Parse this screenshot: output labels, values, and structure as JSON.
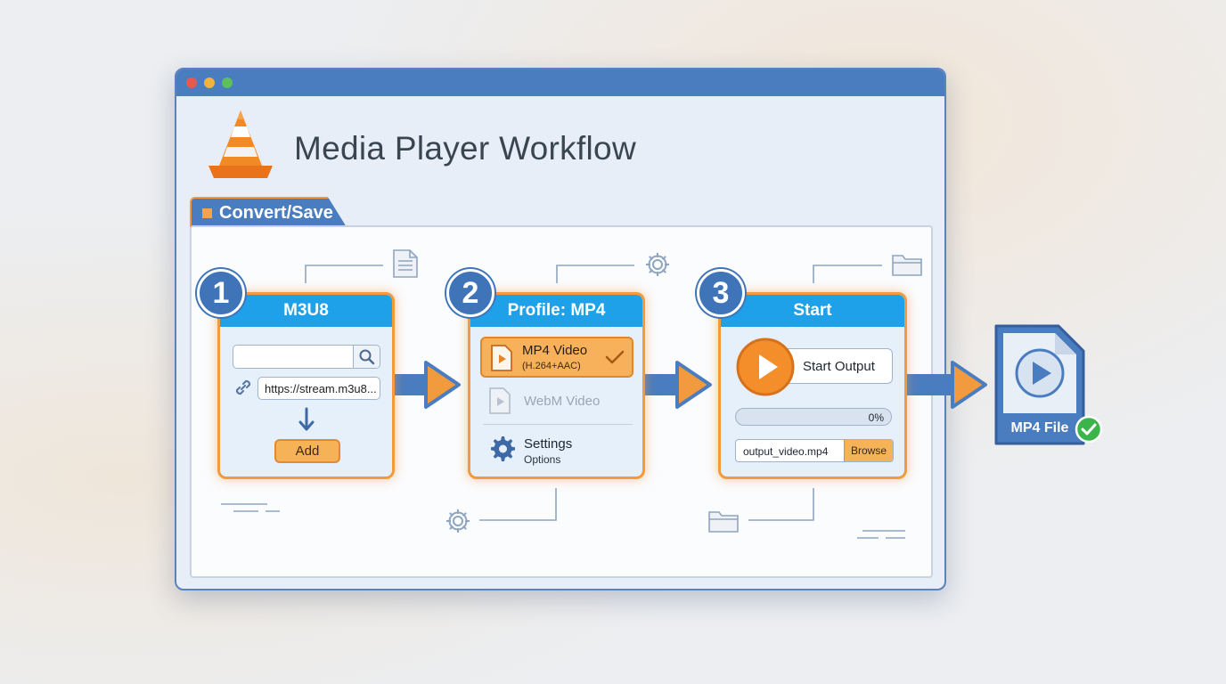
{
  "app": {
    "title": "Media Player Workflow"
  },
  "tab": {
    "label": "Convert/Save"
  },
  "steps": [
    {
      "number": "1",
      "title": "M3U8",
      "url_value": "https://stream.m3u8...",
      "add_label": "Add"
    },
    {
      "number": "2",
      "title": "Profile: MP4",
      "option_selected_title": "MP4 Video",
      "option_selected_sub": "(H.264+AAC)",
      "option_other": "WebM Video",
      "settings_title": "Settings",
      "settings_sub": "Options"
    },
    {
      "number": "3",
      "title": "Start",
      "start_label": "Start Output",
      "progress_text": "0%",
      "progress": 0,
      "filename": "output_video.mp4",
      "browse_label": "Browse"
    }
  ],
  "output": {
    "label": "MP4 File"
  },
  "colors": {
    "accent_blue": "#4a7dc0",
    "card_header": "#1ea1e8",
    "accent_orange": "#f19a3e",
    "success_green": "#3bb54a"
  },
  "icons": [
    "traffic-cone-icon",
    "document-icon",
    "gear-icon",
    "folder-icon",
    "search-icon",
    "link-icon",
    "down-arrow-icon",
    "play-icon",
    "checkmark-icon",
    "check-circle-icon",
    "file-icon"
  ]
}
